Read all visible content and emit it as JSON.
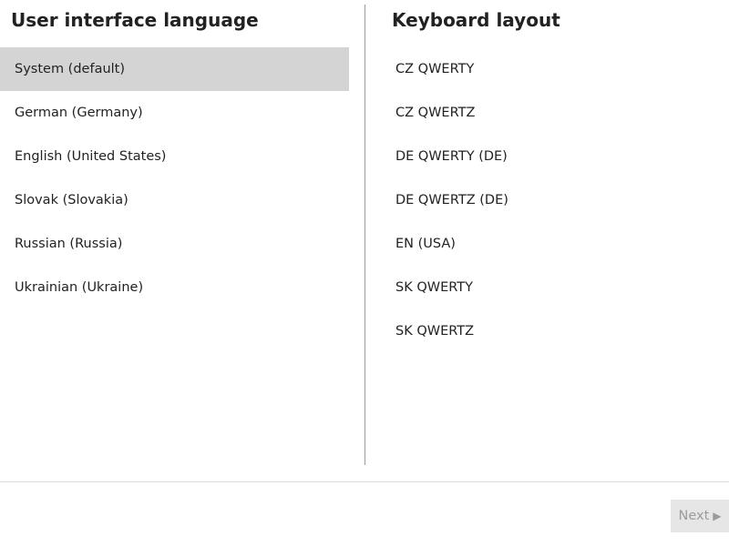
{
  "ui_language": {
    "title": "User interface language",
    "items": [
      {
        "label": "System (default)",
        "selected": true
      },
      {
        "label": "German (Germany)",
        "selected": false
      },
      {
        "label": "English (United States)",
        "selected": false
      },
      {
        "label": "Slovak (Slovakia)",
        "selected": false
      },
      {
        "label": "Russian (Russia)",
        "selected": false
      },
      {
        "label": "Ukrainian (Ukraine)",
        "selected": false
      }
    ]
  },
  "keyboard_layout": {
    "title": "Keyboard layout",
    "items": [
      {
        "label": "CZ QWERTY",
        "selected": false
      },
      {
        "label": "CZ QWERTZ",
        "selected": false
      },
      {
        "label": "DE QWERTY (DE)",
        "selected": false
      },
      {
        "label": "DE QWERTZ (DE)",
        "selected": false
      },
      {
        "label": "EN (USA)",
        "selected": false
      },
      {
        "label": "SK QWERTY",
        "selected": false
      },
      {
        "label": "SK QWERTZ",
        "selected": false
      }
    ]
  },
  "footer": {
    "next_label": "Next",
    "next_icon": "play-arrow-icon",
    "next_enabled": false
  },
  "colors": {
    "selected_bg": "#d4d4d4",
    "button_bg": "#e6e6e6",
    "button_text_disabled": "#9b9b9b"
  }
}
